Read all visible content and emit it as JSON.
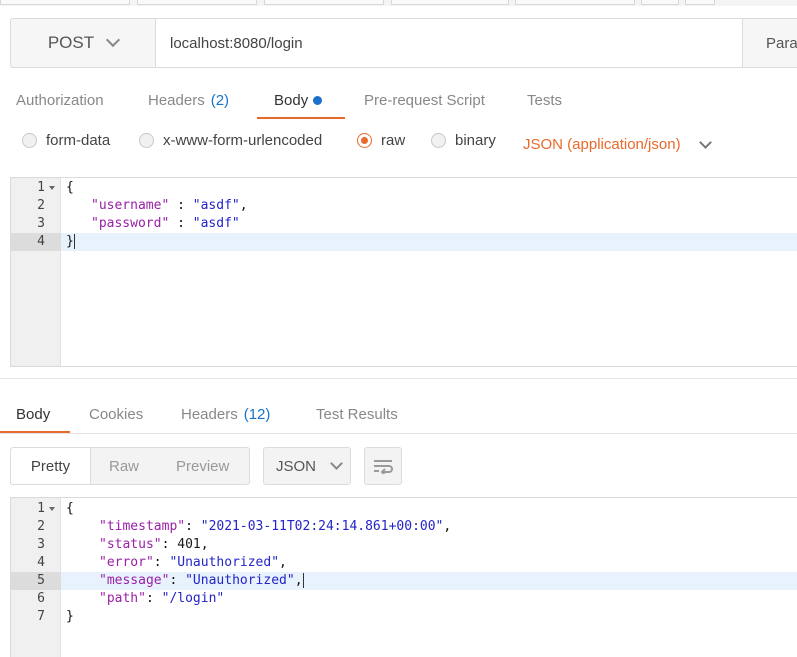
{
  "request": {
    "method": "POST",
    "url": "localhost:8080/login",
    "params_label": "Para"
  },
  "request_tabs": [
    {
      "label": "Authorization"
    },
    {
      "label": "Headers",
      "count": "(2)"
    },
    {
      "label": "Body"
    },
    {
      "label": "Pre-request Script"
    },
    {
      "label": "Tests"
    }
  ],
  "body_types": [
    {
      "label": "form-data"
    },
    {
      "label": "x-www-form-urlencoded"
    },
    {
      "label": "raw",
      "selected": true
    },
    {
      "label": "binary"
    }
  ],
  "content_type": "JSON (application/json)",
  "request_editor": {
    "line_numbers": [
      "1",
      "2",
      "3",
      "4"
    ],
    "lines": {
      "l1": "{",
      "l2_key": "\"username\"",
      "l2_sep": " : ",
      "l2_val": "\"asdf\"",
      "l2_end": ",",
      "l3_key": "\"password\"",
      "l3_sep": " : ",
      "l3_val": "\"asdf\"",
      "l4": "}"
    }
  },
  "response_tabs": [
    {
      "label": "Body"
    },
    {
      "label": "Cookies"
    },
    {
      "label": "Headers",
      "count": "(12)"
    },
    {
      "label": "Test Results"
    }
  ],
  "view_modes": [
    "Pretty",
    "Raw",
    "Preview"
  ],
  "response_format": "JSON",
  "response_editor": {
    "line_numbers": [
      "1",
      "2",
      "3",
      "4",
      "5",
      "6",
      "7"
    ],
    "lines": {
      "open": "{",
      "timestamp_key": "\"timestamp\"",
      "timestamp_val": "\"2021-03-11T02:24:14.861+00:00\"",
      "status_key": "\"status\"",
      "status_val": "401",
      "error_key": "\"error\"",
      "error_val": "\"Unauthorized\"",
      "message_key": "\"message\"",
      "message_val": "\"Unauthorized\"",
      "path_key": "\"path\"",
      "path_val": "\"/login\"",
      "close": "}",
      "colon": ": ",
      "comma": ","
    }
  },
  "colors": {
    "accent": "#e86a2b",
    "count_blue": "#1a73c8",
    "json_key": "#9a1fa8",
    "json_string": "#2424c8"
  }
}
